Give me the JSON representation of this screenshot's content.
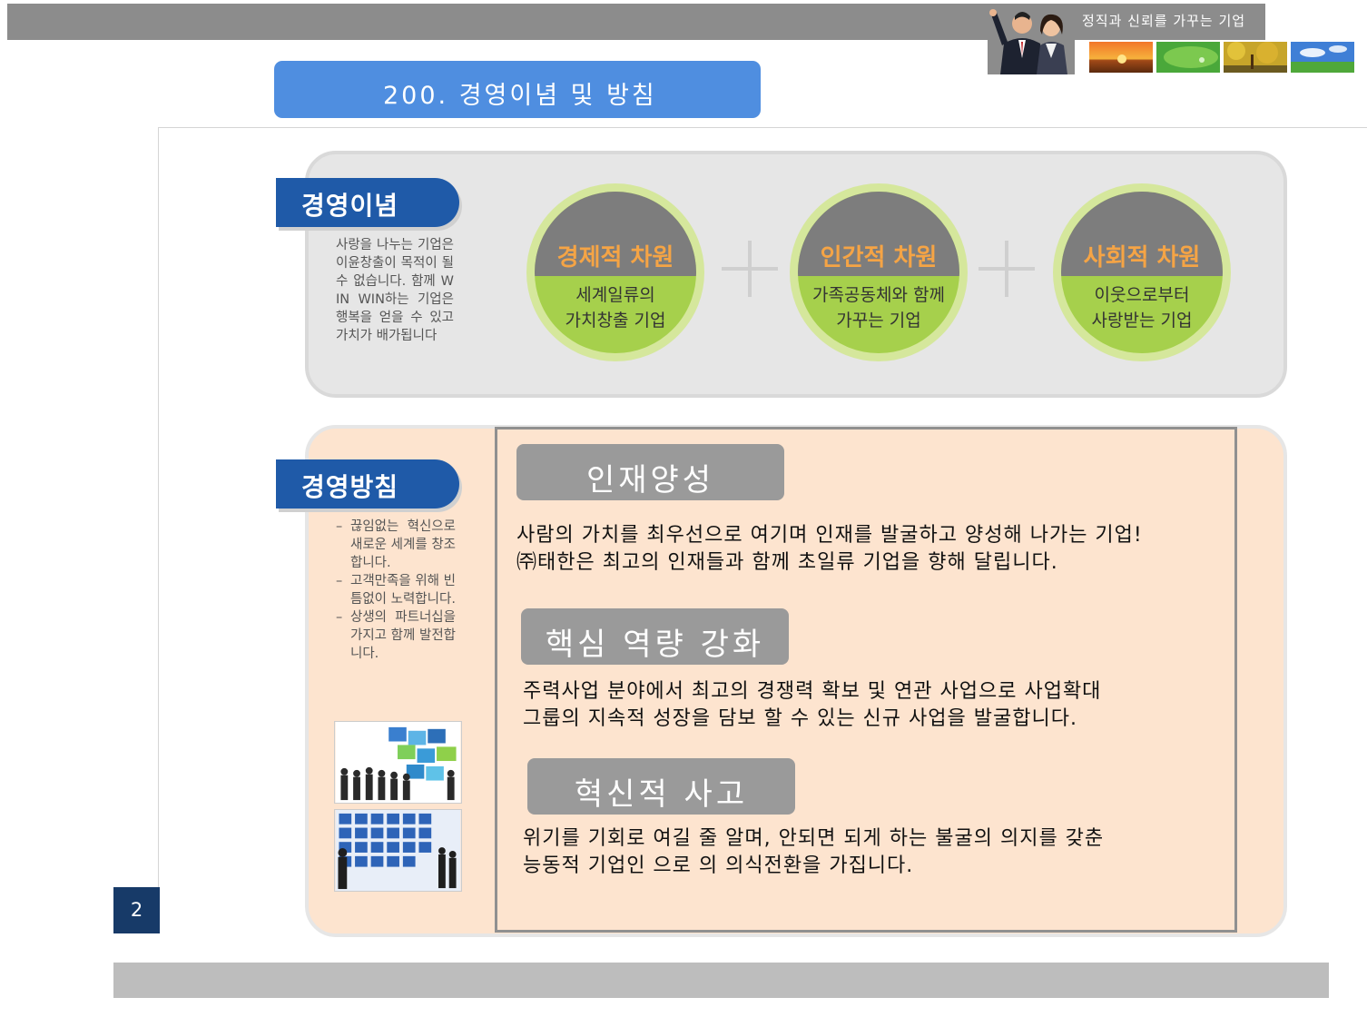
{
  "header": {
    "slogan": "정직과 신뢰를 가꾸는 기업",
    "title": "200.  경영이념 및 방침"
  },
  "philosophy": {
    "tab_label": "경영이념",
    "description": "사랑을 나누는 기업은 이윤창출이 목적이 될수 없습니다. 함께 WIN WIN하는 기업은 행복을 얻을 수 있고 가치가 배가됩니다",
    "circles": [
      {
        "title": "경제적 차원",
        "line1": "세계일류의",
        "line2": "가치창출 기업"
      },
      {
        "title": "인간적 차원",
        "line1": "가족공동체와 함께",
        "line2": "가꾸는 기업"
      },
      {
        "title": "사회적 차원",
        "line1": "이웃으로부터",
        "line2": "사랑받는 기업"
      }
    ]
  },
  "policy": {
    "tab_label": "경영방침",
    "bullets": [
      "끊임없는 혁신으로 새로운 세계를 창조합니다.",
      "고객만족을 위해 빈틈없이 노력합니다.",
      "상생의 파트너십을 가지고 함께 발전합니다."
    ],
    "items": [
      {
        "heading": "인재양성",
        "line1": "사람의 가치를 최우선으로 여기며 인재를 발굴하고 양성해 나가는 기업!",
        "line2": "㈜태한은 최고의 인재들과 함께 초일류 기업을 향해 달립니다."
      },
      {
        "heading": "핵심 역량 강화",
        "line1": "주력사업  분야에서 최고의 경쟁력 확보 및 연관 사업으로 사업확대",
        "line2": "그룹의 지속적 성장을 담보 할 수 있는 신규 사업을  발굴합니다."
      },
      {
        "heading": "혁신적 사고",
        "line1": "위기를 기회로 여길 줄 알며, 안되면 되게 하는 불굴의  의지를  갖춘",
        "line2": "능동적 기업인 으로 의 의식전환을  가집니다."
      }
    ]
  },
  "footer": {
    "page_number": "2"
  },
  "colors": {
    "title_blue": "#4f8ee0",
    "tab_navy": "#1f5aa8",
    "circle_green": "#a6d04c",
    "circle_title_orange": "#f5a445",
    "peach_panel": "#fde4cf"
  },
  "icons": [
    "people-pointing-photo",
    "sunset-thumbnail",
    "green-leaf-thumbnail",
    "autumn-tree-thumbnail",
    "sky-field-thumbnail",
    "business-puzzle-photo",
    "business-screens-photo"
  ]
}
